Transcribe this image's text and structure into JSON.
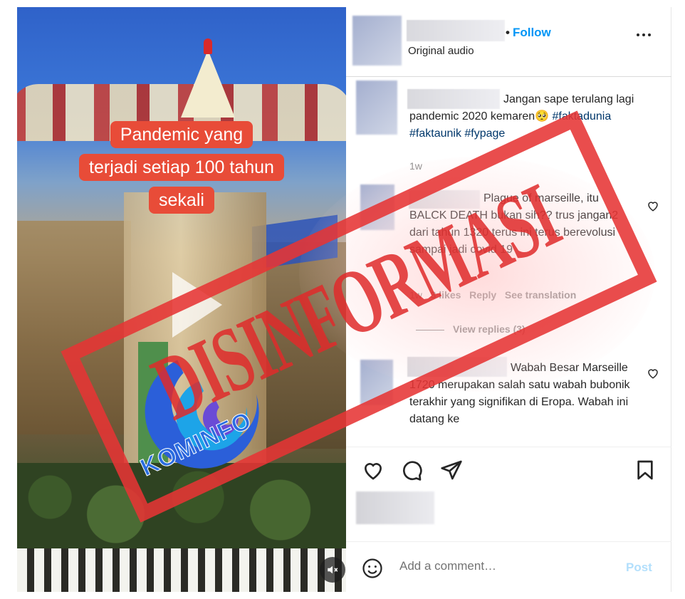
{
  "video": {
    "caption_lines": [
      "Pandemic yang",
      "terjadi setiap 100 tahun",
      "sekali"
    ]
  },
  "header": {
    "follow_label": "Follow",
    "audio_label": "Original audio"
  },
  "comments": [
    {
      "text": "Jangan sape terulang lagi pandemic 2020 kemaren🥺",
      "tags": "#faktadunia #faktaunik #fypage",
      "time": "1w"
    },
    {
      "text": "Plague of marseille, itu BALCK DEATH bukan sih?? trus jangan2 dari tahun 1320 terus ini terus berevolusi sampai jadi covid 19",
      "time": "1w",
      "likes": "3 likes",
      "reply": "Reply",
      "translate": "See translation",
      "view_replies": "View replies (3)"
    },
    {
      "text": "Wabah Besar Marseille 1720 merupakan salah satu wabah bubonik terakhir yang signifikan di Eropa. Wabah ini datang ke"
    }
  ],
  "comment_bar": {
    "placeholder": "Add a comment…",
    "post_label": "Post"
  },
  "overlay": {
    "stamp_text": "DISINFORMASI",
    "logo_text": "KOMINFO"
  },
  "colors": {
    "follow_blue": "#0095f6",
    "stamp_red": "#e63434",
    "caption_bg": "#e84c38",
    "post_disabled": "#b2dffc"
  }
}
